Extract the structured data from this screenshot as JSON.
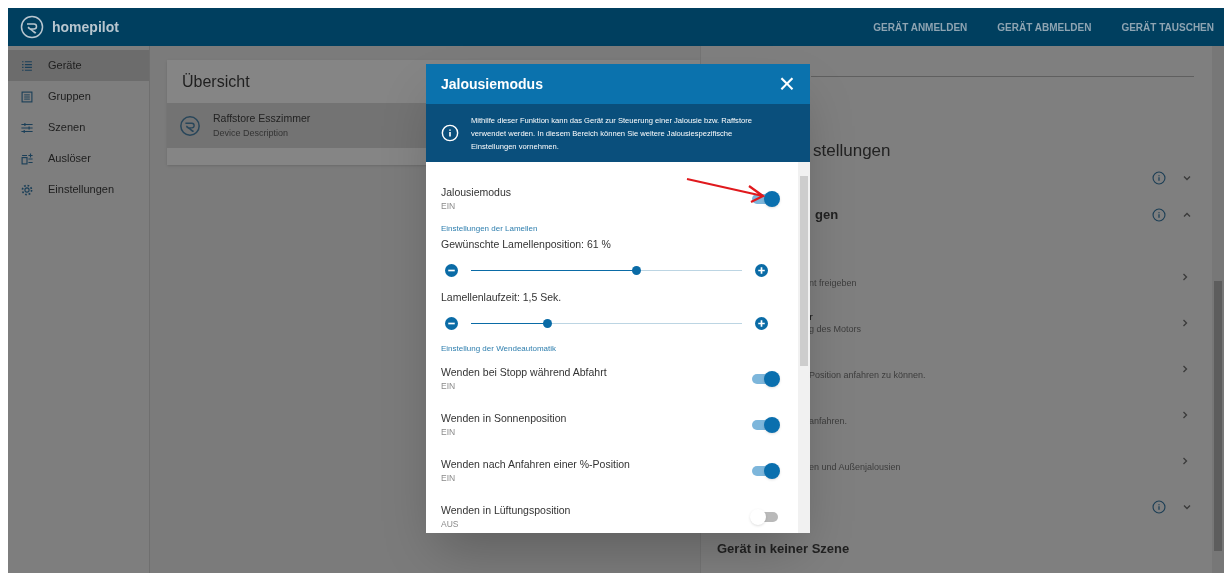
{
  "app": {
    "name": "homepilot"
  },
  "top_actions": [
    "GERÄT ANMELDEN",
    "GERÄT ABMELDEN",
    "GERÄT TAUSCHEN"
  ],
  "sidebar": {
    "items": [
      {
        "label": "Geräte",
        "selected": true
      },
      {
        "label": "Gruppen",
        "selected": false
      },
      {
        "label": "Szenen",
        "selected": false
      },
      {
        "label": "Auslöser",
        "selected": false
      },
      {
        "label": "Einstellungen",
        "selected": false
      }
    ]
  },
  "overview": {
    "title": "Übersicht",
    "devices": [
      {
        "name": "Raffstore Esszimmer",
        "description": "Device Description",
        "selected": true
      }
    ]
  },
  "detail": {
    "heading": "stellungen",
    "sections": [
      {
        "expanded": false
      }
    ],
    "expanded_title": "gen",
    "rows": [
      {
        "subtitle": "nt freigeben"
      },
      {
        "title": "r",
        "subtitle": "g des Motors"
      },
      {
        "subtitle": "Position anfahren zu können."
      },
      {
        "subtitle": "anfahren."
      },
      {
        "subtitle": "en und Außenjalousien"
      }
    ],
    "footer": "Gerät in keiner Szene"
  },
  "modal": {
    "title": "Jalousiemodus",
    "close": "×",
    "info": "Mithilfe dieser Funktion kann das Gerät zur Steuerung einer Jalousie bzw. Raffstore verwendet werden. In diesem Bereich können Sie weitere Jalousiespezifische Einstellungen vornehmen.",
    "items": [
      {
        "kind": "toggle",
        "label": "Jalousiemodus",
        "status": "EIN",
        "on": true
      },
      {
        "kind": "section",
        "label": "Einstellungen der Lamellen"
      },
      {
        "kind": "slider",
        "label": "Gewünschte Lamellenposition: 61 %",
        "level": 0.61
      },
      {
        "kind": "slider",
        "label": "Lamellenlaufzeit: 1,5 Sek.",
        "level": 0.28
      },
      {
        "kind": "section",
        "label": "Einstellung der Wendeautomatik"
      },
      {
        "kind": "toggle",
        "label": "Wenden bei Stopp während Abfahrt",
        "status": "EIN",
        "on": true
      },
      {
        "kind": "toggle",
        "label": "Wenden in Sonnenposition",
        "status": "EIN",
        "on": true
      },
      {
        "kind": "toggle",
        "label": "Wenden nach Anfahren einer %-Position",
        "status": "EIN",
        "on": true
      },
      {
        "kind": "toggle",
        "label": "Wenden in Lüftungsposition",
        "status": "AUS",
        "on": false
      }
    ]
  }
}
